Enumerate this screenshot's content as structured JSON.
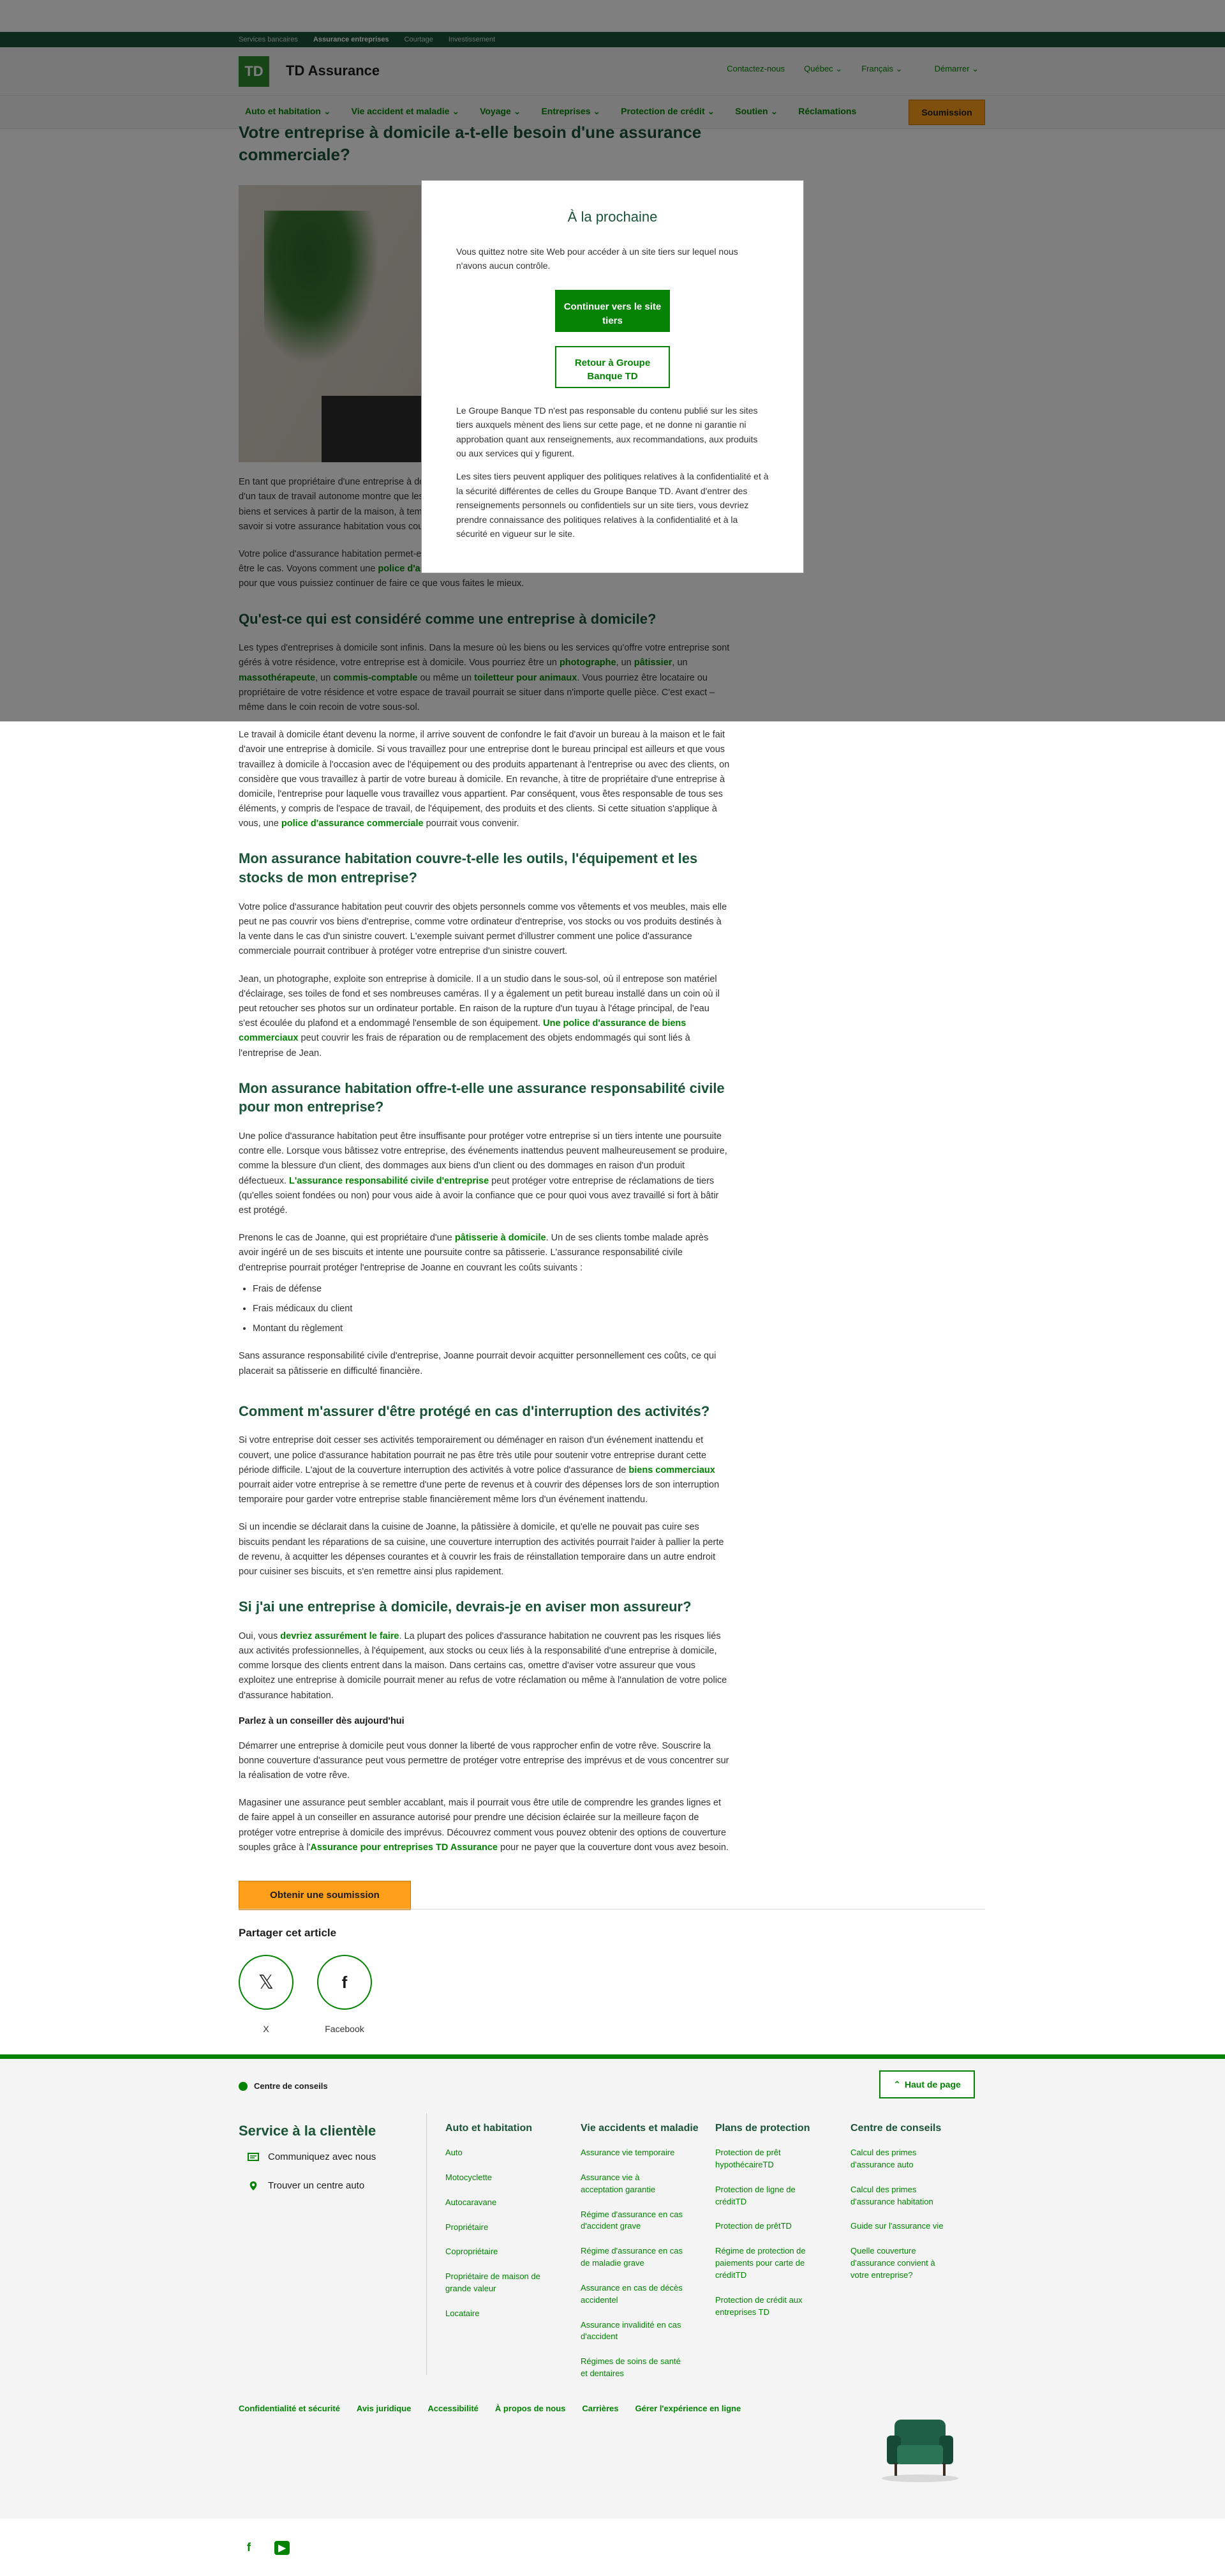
{
  "util_bar": {
    "items": [
      "Services bancaires",
      "Assurance entreprises",
      "Courtage",
      "Investissement"
    ],
    "active_index": 1
  },
  "header": {
    "logo_text": "TD",
    "brand": "TD Assurance",
    "links": [
      "Contactez-nous",
      "Québec",
      "Français",
      "Démarrer"
    ]
  },
  "nav": {
    "items": [
      "Auto et habitation",
      "Vie accident et maladie",
      "Voyage",
      "Entreprises",
      "Protection de crédit",
      "Soutien",
      "Réclamations"
    ],
    "cta": "Soumission"
  },
  "article": {
    "title": "Votre entreprise à domicile a-t-elle besoin d'une assurance commerciale?",
    "intro1": "En tant que propriétaire d'une entreprise à domicile, vous faites partie de nouveaux sommets. La croissance en 2021 d'un taux de travail autonome montre que les Canadiens prennent leur destin en main. Si votre entreprise offre des biens et services à partir de la maison, à temps plein ou à temps partiel, de votre domicile, il est important de bien savoir si votre assurance habitation vous couvre adéquatement.",
    "intro2_a": "Votre police d'assurance habitation permet-elle de couvrir votre entreprise aussi? En grande partie, cela peut ne pas être le cas. Voyons comment une ",
    "intro2_link": "police d'assurance pour entreprises",
    "intro2_b": " peut contribuer à protéger votre entreprise pour que vous puissiez continuer de faire ce que vous faites le mieux.",
    "h_qu": "Qu'est-ce qui est considéré comme une entreprise à domicile?",
    "qu_p1_a": "Les types d'entreprises à domicile sont infinis. Dans la mesure où les biens ou les services qu'offre votre entreprise sont gérés à votre résidence, votre entreprise est à domicile. Vous pourriez être un ",
    "qu_p1_l1": "photographe",
    "qu_p1_b": ", un ",
    "qu_p1_l2": "pâtissier",
    "qu_p1_c": ", un ",
    "qu_p1_l3": "massothérapeute",
    "qu_p1_d": ", un ",
    "qu_p1_l4": "commis-comptable",
    "qu_p1_e": " ou même un ",
    "qu_p1_l5": "toiletteur pour animaux",
    "qu_p1_f": ". Vous pourriez être locataire ou propriétaire de votre résidence et votre espace de travail pourrait se situer dans n'importe quelle pièce. C'est exact – même dans le coin recoin de votre sous-sol.",
    "qu_p2_a": "Le travail à domicile étant devenu la norme, il arrive souvent de confondre le fait d'avoir un bureau à la maison et le fait d'avoir une entreprise à domicile. Si vous travaillez pour une entreprise dont le bureau principal est ailleurs et que vous travaillez à domicile à l'occasion avec de l'équipement ou des produits appartenant à l'entreprise ou avec des clients, on considère que vous travaillez à partir de votre bureau à domicile. En revanche, à titre de propriétaire d'une entreprise à domicile, l'entreprise pour laquelle vous travaillez vous appartient. Par conséquent, vous êtes responsable de tous ses éléments, y compris de l'espace de travail, de l'équipement, des produits et des clients. Si cette situation s'applique à vous, une ",
    "qu_p2_link": "police d'assurance commerciale",
    "qu_p2_b": " pourrait vous convenir.",
    "h_tools": "Mon assurance habitation couvre-t-elle les outils, l'équipement et les stocks de mon entreprise?",
    "tools_p1": "Votre police d'assurance habitation peut couvrir des objets personnels comme vos vêtements et vos meubles, mais elle peut ne pas couvrir vos biens d'entreprise, comme votre ordinateur d'entreprise, vos stocks ou vos produits destinés à la vente dans le cas d'un sinistre couvert. L'exemple suivant permet d'illustrer comment une police d'assurance commerciale pourrait contribuer à protéger votre entreprise d'un sinistre couvert.",
    "tools_p2_a": "Jean, un photographe, exploite son entreprise à domicile. Il a un studio dans le sous-sol, où il entrepose son matériel d'éclairage, ses toiles de fond et ses nombreuses caméras. Il y a également un petit bureau installé dans un coin où il peut retoucher ses photos sur un ordinateur portable. En raison de la rupture d'un tuyau à l'étage principal, de l'eau s'est écoulée du plafond et a endommagé l'ensemble de son équipement. ",
    "tools_p2_link": "Une police d'assurance de biens commerciaux",
    "tools_p2_b": " peut couvrir les frais de réparation ou de remplacement des objets endommagés qui sont liés à l'entreprise de Jean.",
    "h_liab": "Mon assurance habitation offre-t-elle une assurance responsabilité civile pour mon entreprise?",
    "liab_p1_a": "Une police d'assurance habitation peut être insuffisante pour protéger votre entreprise si un tiers intente une poursuite contre elle. Lorsque vous bâtissez votre entreprise, des événements inattendus peuvent malheureusement se produire, comme la blessure d'un client, des dommages aux biens d'un client ou des dommages en raison d'un produit défectueux. ",
    "liab_p1_link": "L'assurance responsabilité civile d'entreprise",
    "liab_p1_b": " peut protéger votre entreprise de réclamations de tiers (qu'elles soient fondées ou non) pour vous aide à avoir la confiance que ce pour quoi vous avez travaillé si fort à bâtir est protégé.",
    "liab_p2_a": "Prenons le cas de Joanne, qui est propriétaire d'une ",
    "liab_p2_link": "pâtisserie à domicile",
    "liab_p2_b": ". Un de ses clients tombe malade après avoir ingéré un de ses biscuits et intente une poursuite contre sa pâtisserie. L'assurance responsabilité civile d'entreprise pourrait protéger l'entreprise de Joanne en couvrant les coûts suivants :",
    "liab_list": [
      "Frais de défense",
      "Frais médicaux du client",
      "Montant du règlement"
    ],
    "liab_p3": "Sans assurance responsabilité civile d'entreprise, Joanne pourrait devoir acquitter personnellement ces coûts, ce qui placerait sa pâtisserie en difficulté financière.",
    "h_interrupt": "Comment m'assurer d'être protégé en cas d'interruption des activités?",
    "int_p1_a": "Si votre entreprise doit cesser ses activités temporairement ou déménager en raison d'un événement inattendu et couvert, une police d'assurance habitation pourrait ne pas être très utile pour soutenir votre entreprise durant cette période difficile. L'ajout de la couverture interruption des activités à votre police d'assurance de ",
    "int_p1_link": "biens commerciaux",
    "int_p1_b": " pourrait aider votre entreprise à se remettre d'une perte de revenus et à couvrir des dépenses lors de son interruption temporaire pour garder votre entreprise stable financièrement même lors d'un événement inattendu.",
    "int_p2": "Si un incendie se déclarait dans la cuisine de Joanne, la pâtissière à domicile, et qu'elle ne pouvait pas cuire ses biscuits pendant les réparations de sa cuisine, une couverture interruption des activités pourrait l'aider à pallier la perte de revenu, à acquitter les dépenses courantes et à couvrir les frais de réinstallation temporaire dans un autre endroit pour cuisiner ses biscuits, et s'en remettre ainsi plus rapidement.",
    "h_notify": "Si j'ai une entreprise à domicile, devrais-je en aviser mon assureur?",
    "not_p1_a": "Oui, vous ",
    "not_p1_link": "devriez assurément le faire",
    "not_p1_b": ". La plupart des polices d'assurance habitation ne couvrent pas les risques liés aux activités professionnelles, à l'équipement, aux stocks ou ceux liés à la responsabilité d'une entreprise à domicile, comme lorsque des clients entrent dans la maison. Dans certains cas, omettre d'aviser votre assureur que vous exploitez une entreprise à domicile pourrait mener au refus de votre réclamation ou même à l'annulation de votre police d'assurance habitation.",
    "h_advisor": "Parlez à un conseiller dès aujourd'hui",
    "adv_p1": "Démarrer une entreprise à domicile peut vous donner la liberté de vous rapprocher enfin de votre rêve. Souscrire la bonne couverture d'assurance peut vous permettre de protéger votre entreprise des imprévus et de vous concentrer sur la réalisation de votre rêve.",
    "adv_p2_a": "Magasiner une assurance peut sembler accablant, mais il pourrait vous être utile de comprendre les grandes lignes et de faire appel à un conseiller en assurance autorisé pour prendre une décision éclairée sur la meilleure façon de protéger votre entreprise à domicile des imprévus. Découvrez comment vous pouvez obtenir des options de couverture souples grâce à l'",
    "adv_p2_link": "Assurance pour entreprises TD Assurance",
    "adv_p2_b": " pour ne payer que la couverture dont vous avez besoin.",
    "quote_button": "Obtenir une soumission"
  },
  "share": {
    "title": "Partager cet article",
    "x_label": "X",
    "facebook_label": "Facebook"
  },
  "modal": {
    "title": "À la prochaine",
    "intro": "Vous quittez notre site Web pour accéder à un site tiers sur lequel nous n'avons aucun contrôle.",
    "continue_button": "Continuer vers le site tiers",
    "return_button": "Retour à Groupe Banque TD",
    "disclaimer1": "Le Groupe Banque TD n'est pas responsable du contenu publié sur les sites tiers auxquels mènent des liens sur cette page, et ne donne ni garantie ni approbation quant aux renseignements, aux recommandations, aux produits ou aux services qui y figurent.",
    "disclaimer2": "Les sites tiers peuvent appliquer des politiques relatives à la confidentialité et à la sécurité différentes de celles du Groupe Banque TD. Avant d'entrer des renseignements personnels ou confidentiels sur un site tiers, vous devriez prendre connaissance des politiques relatives à la confidentialité et à la sécurité en vigueur sur le site."
  },
  "footer": {
    "breadcrumb": "Centre de conseils",
    "back_to_top": "Haut de page",
    "service_title": "Service à la clientèle",
    "service_items": [
      "Communiquez avec nous",
      "Trouver un centre auto"
    ],
    "columns": [
      {
        "title": "Auto et habitation",
        "links": [
          "Auto",
          "Motocyclette",
          "Autocaravane",
          "Propriétaire",
          "Copropriétaire",
          "Propriétaire de maison de grande valeur",
          "Locataire"
        ]
      },
      {
        "title": "Vie accidents et maladie",
        "links": [
          "Assurance vie temporaire",
          "Assurance vie à acceptation garantie",
          "Régime d'assurance en cas d'accident grave",
          "Régime d'assurance en cas de maladie grave",
          "Assurance en cas de décès accidentel",
          "Assurance invalidité en cas d'accident",
          "Régimes de soins de santé et dentaires"
        ]
      },
      {
        "title": "Plans de protection",
        "links": [
          "Protection de prêt hypothécaireTD",
          "Protection de ligne de créditTD",
          "Protection de prêtTD",
          "Régime de protection de paiements pour carte de créditTD",
          "Protection de crédit aux entreprises TD"
        ]
      },
      {
        "title": "Centre de conseils",
        "links": [
          "Calcul des primes d'assurance auto",
          "Calcul des primes d'assurance habitation",
          "Guide sur l'assurance vie",
          "Quelle couverture d'assurance convient à votre entreprise?"
        ]
      }
    ],
    "legal_links": [
      "Confidentialité et sécurité",
      "Avis juridique",
      "Accessibilité",
      "À propos de nous",
      "Carrières",
      "Gérer l'expérience en ligne"
    ]
  },
  "social": {
    "facebook": "f",
    "youtube": "▶"
  },
  "colors": {
    "brand_green": "#038203",
    "dark_green": "#1a5336",
    "cta_orange": "#ff9f1a"
  }
}
